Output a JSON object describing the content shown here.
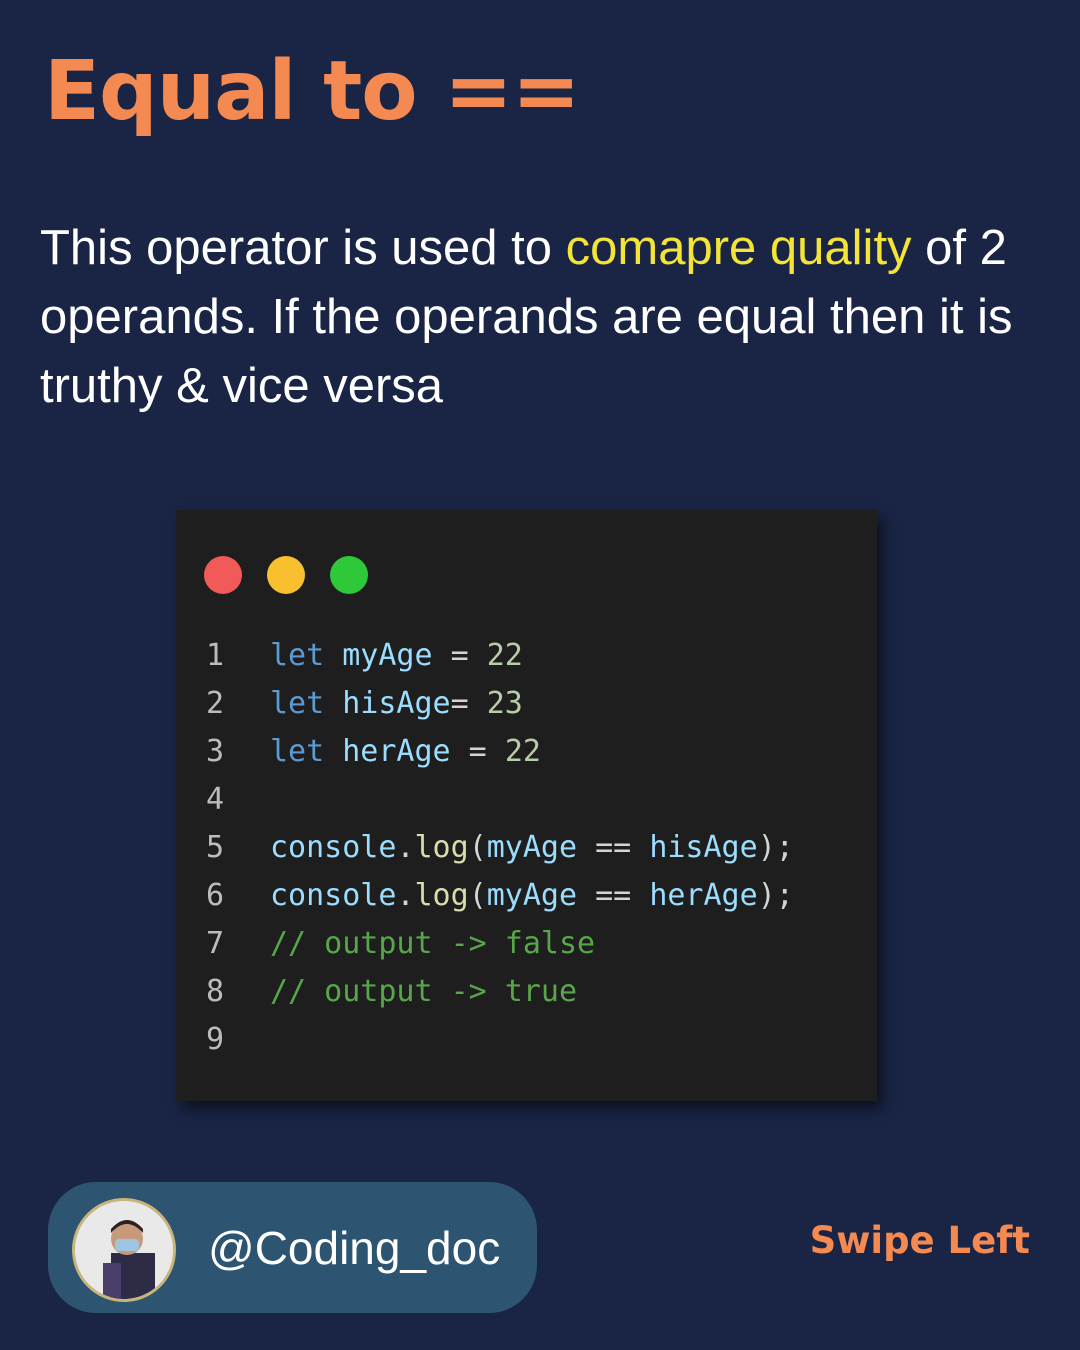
{
  "title": "Equal to ==",
  "description": {
    "part1": "This operator is used to ",
    "highlight": "comapre quality",
    "part2": " of 2 operands. If the operands are equal then it is truthy & vice versa"
  },
  "colors": {
    "background": "#1a2546",
    "title": "#f48a52",
    "highlight": "#f3e437",
    "code_background": "#1e1e1e",
    "profile_pill": "#2d5470",
    "dot_red": "#f25a5a",
    "dot_yellow": "#f8bf2e",
    "dot_green": "#2ec838"
  },
  "code": {
    "line_numbers": [
      "1",
      "2",
      "3",
      "4",
      "5",
      "6",
      "7",
      "8",
      "9"
    ],
    "l1": {
      "kw": "let",
      "var": "myAge",
      "op": " = ",
      "num": "22"
    },
    "l2": {
      "kw": "let",
      "var": "hisAge",
      "op": "= ",
      "num": "23"
    },
    "l3": {
      "kw": "let",
      "var": "herAge",
      "op": " = ",
      "num": "22"
    },
    "l5": {
      "obj": "console",
      "dot": ".",
      "fn": "log",
      "open": "(",
      "a": "myAge",
      "op": " == ",
      "b": "hisAge",
      "close": ");"
    },
    "l6": {
      "obj": "console",
      "dot": ".",
      "fn": "log",
      "open": "(",
      "a": "myAge",
      "op": " == ",
      "b": "herAge",
      "close": ");"
    },
    "l7": "// output -> false",
    "l8": "// output -> true"
  },
  "profile": {
    "avatar_icon": "user-avatar",
    "handle": "@Coding_doc"
  },
  "swipe_label": "Swipe Left"
}
